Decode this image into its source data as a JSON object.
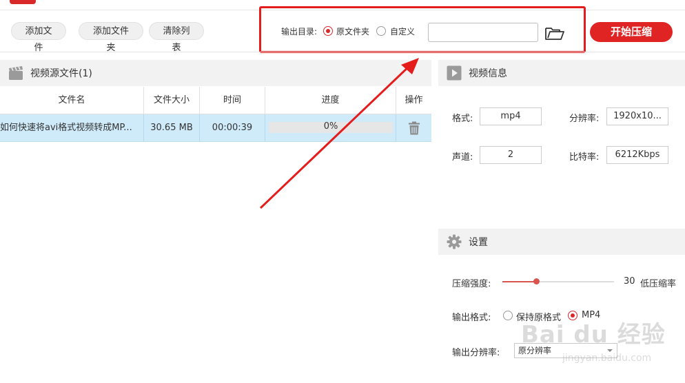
{
  "toolbar": {
    "add_file": "添加文件",
    "add_folder": "添加文件夹",
    "clear_list": "清除列表",
    "output_dir_label": "输出目录:",
    "option_original": "原文件夹",
    "option_custom": "自定义",
    "path_value": "",
    "start_label": "开始压缩"
  },
  "source": {
    "title": "视频源文件(1)",
    "columns": [
      "文件名",
      "文件大小",
      "时间",
      "进度",
      "操作"
    ],
    "rows": [
      {
        "name": "如何快速将avi格式视频转成MP...",
        "size": "30.65 MB",
        "duration": "00:00:39",
        "progress_text": "0%",
        "progress": 0
      }
    ]
  },
  "info": {
    "title": "视频信息",
    "format_label": "格式:",
    "format_value": "mp4",
    "resolution_label": "分辨率:",
    "resolution_value": "1920x10...",
    "channels_label": "声道:",
    "channels_value": "2",
    "bitrate_label": "比特率:",
    "bitrate_value": "6212Kbps"
  },
  "settings": {
    "title": "设置",
    "strength_label": "压缩强度:",
    "strength_value": "30",
    "strength_fraction": 0.3,
    "strength_desc": "低压缩率",
    "format_label": "输出格式:",
    "format_keep": "保持原格式",
    "format_mp4": "MP4",
    "resolution_label": "输出分辨率:",
    "resolution_value": "原分辨率"
  },
  "watermark": {
    "brand": "Bai du 经验",
    "url": "jingyan.baidu.com"
  },
  "colors": {
    "accent": "#e02323",
    "annotation": "#e51c1c",
    "row_selected": "#cfeaf9"
  }
}
